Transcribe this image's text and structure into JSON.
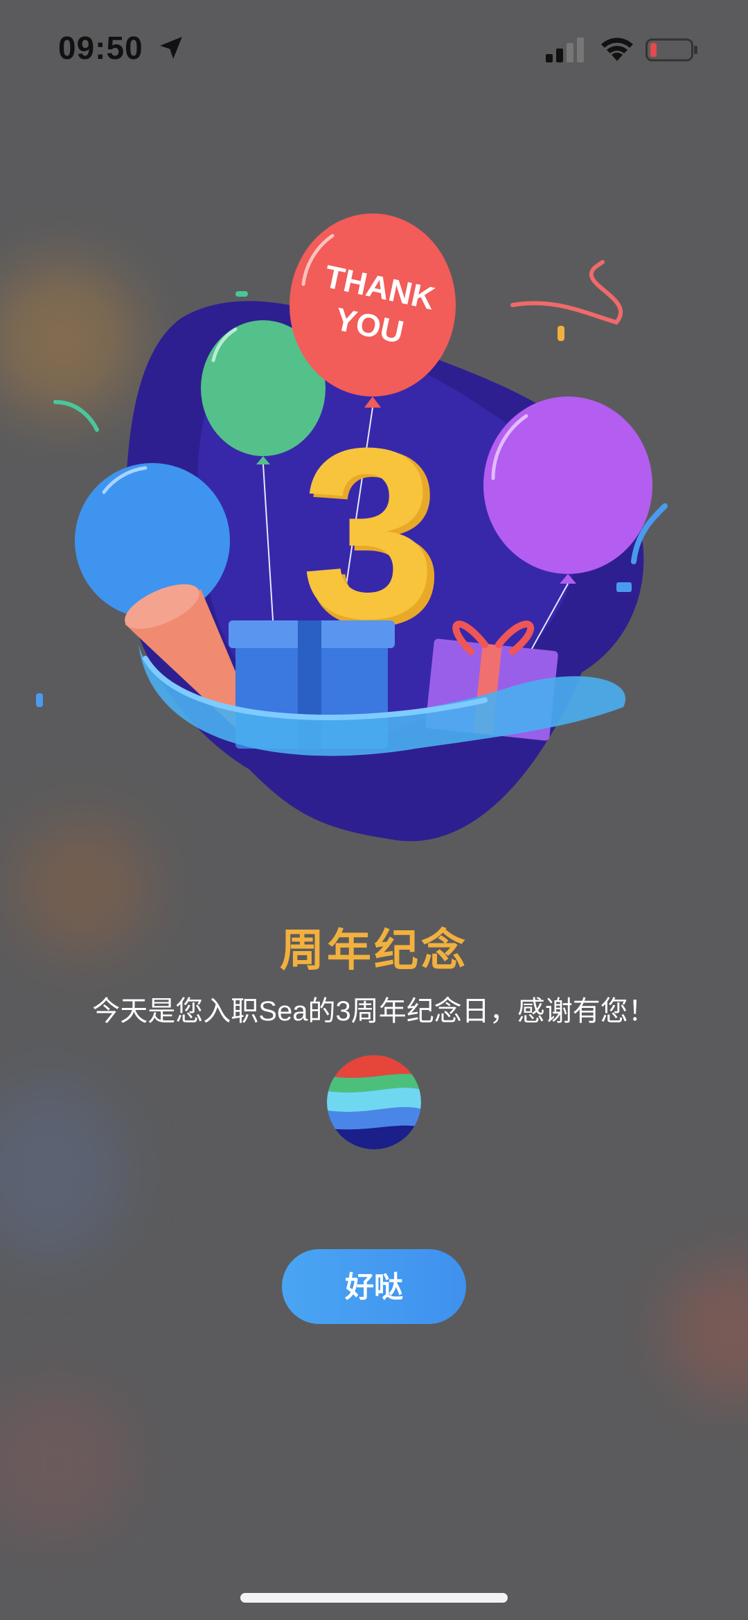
{
  "status_bar": {
    "time": "09:50",
    "icons": [
      "location-arrow-icon",
      "cellular-signal-icon",
      "wifi-icon",
      "battery-low-icon"
    ],
    "battery_color": "#e5484d"
  },
  "illustration": {
    "balloon_text_line1": "THANK",
    "balloon_text_line2": "YOU",
    "number": "3"
  },
  "dialog": {
    "title": "周年纪念",
    "message": "今天是您入职Sea的3周年纪念日，感谢有您！",
    "button_label": "好哒",
    "title_color": "#f2b13e",
    "button_color": "#4aa5f3"
  }
}
